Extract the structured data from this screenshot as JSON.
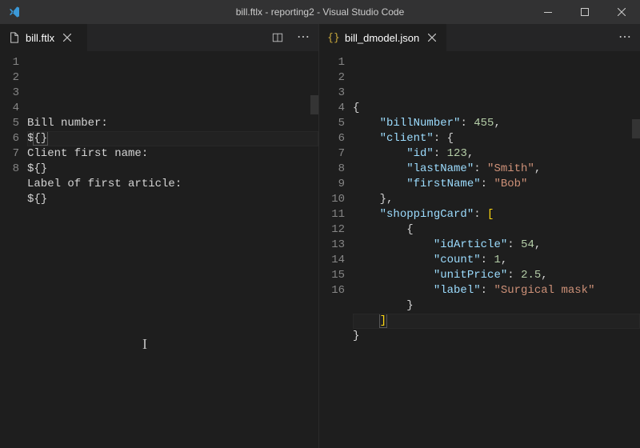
{
  "titlebar": {
    "title": "bill.ftlx - reporting2 - Visual Studio Code"
  },
  "left_editor": {
    "tab": {
      "filename": "bill.ftlx"
    },
    "lines": [
      "",
      "Bill number:",
      "${}",
      "Client first name:",
      "${}",
      "Label of first article:",
      "${}",
      ""
    ]
  },
  "right_editor": {
    "tab": {
      "filename": "bill_dmodel.json"
    },
    "json": {
      "billNumber": 455,
      "client": {
        "id": 123,
        "lastName": "Smith",
        "firstName": "Bob"
      },
      "shoppingCard": [
        {
          "idArticle": 54,
          "count": 1,
          "unitPrice": 2.5,
          "label": "Surgical mask"
        }
      ]
    }
  }
}
